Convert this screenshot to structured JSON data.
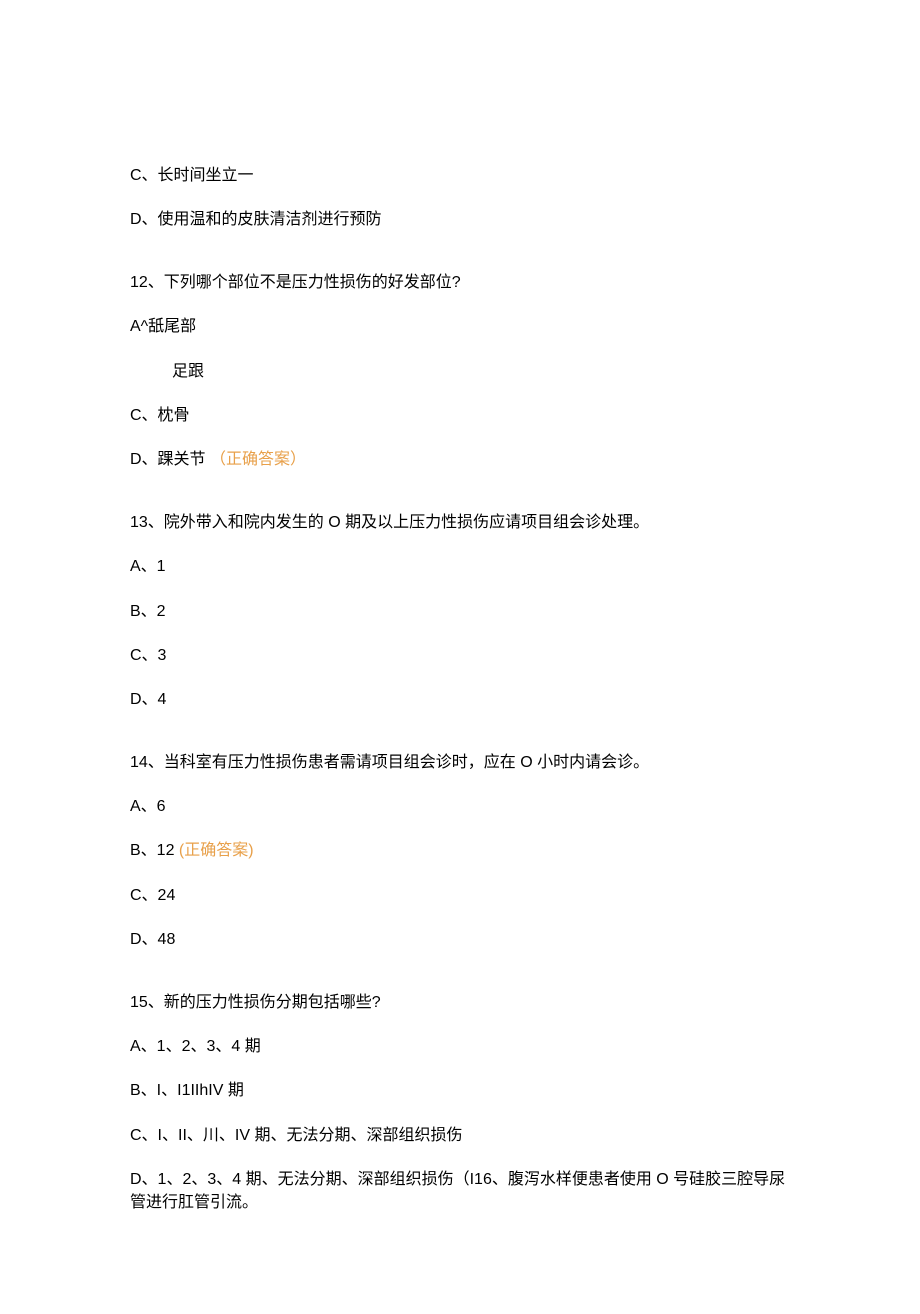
{
  "q11_optC": "C、长时间坐立一",
  "q11_optD": "D、使用温和的皮肤清洁剂进行预防",
  "q12_stem": "12、下列哪个部位不是压力性损伤的好发部位?",
  "q12_optA": "A^舐尾部",
  "q12_optA_sub": "足跟",
  "q12_optC": "C、枕骨",
  "q12_optD_label": "D、踝关节 ",
  "q12_optD_correct": "（正确答案）",
  "q13_stem": "13、院外带入和院内发生的 O 期及以上压力性损伤应请项目组会诊处理。",
  "q13_optA": "A、1",
  "q13_optB": "B、2",
  "q13_optC": "C、3",
  "q13_optD": "D、4",
  "q14_stem": "14、当科室有压力性损伤患者需请项目组会诊时，应在 O 小时内请会诊。",
  "q14_optA": "A、6",
  "q14_optB_label": "B、12 ",
  "q14_optB_correct": "(正确答案)",
  "q14_optC": "C、24",
  "q14_optD": "D、48",
  "q15_stem": "15、新的压力性损伤分期包括哪些?",
  "q15_optA": "A、1、2、3、4 期",
  "q15_optB": "B、I、I1IIhIV 期",
  "q15_optC": "C、I、II、川、IV 期、无法分期、深部组织损伤",
  "q15_optD": "D、1、2、3、4 期、无法分期、深部组织损伤（I16、腹泻水样便患者使用 O 号硅胶三腔导尿管进行肛管引流。"
}
